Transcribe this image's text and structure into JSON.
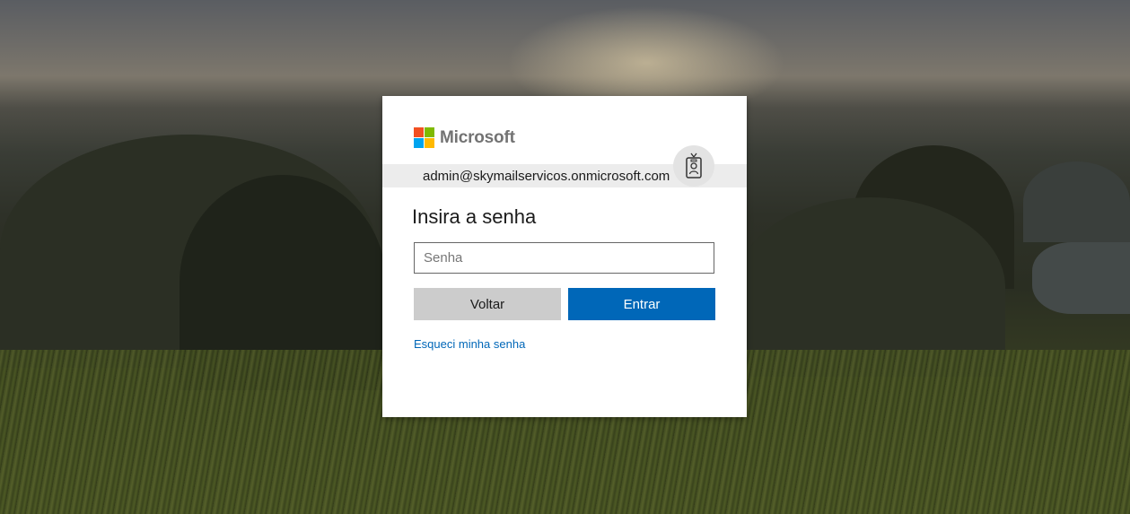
{
  "brand": {
    "name": "Microsoft",
    "logo_colors": [
      "#f25022",
      "#7fba00",
      "#00a4ef",
      "#ffb900"
    ]
  },
  "identity": {
    "email": "admin@skymailservicos.onmicrosoft.com",
    "badge_icon": "id-badge-icon"
  },
  "form": {
    "title": "Insira a senha",
    "password_placeholder": "Senha",
    "password_value": "",
    "back_label": "Voltar",
    "signin_label": "Entrar",
    "forgot_label": "Esqueci minha senha"
  },
  "colors": {
    "primary": "#0067b8",
    "secondary_button": "#cccccc",
    "identity_bar": "#ececec"
  }
}
